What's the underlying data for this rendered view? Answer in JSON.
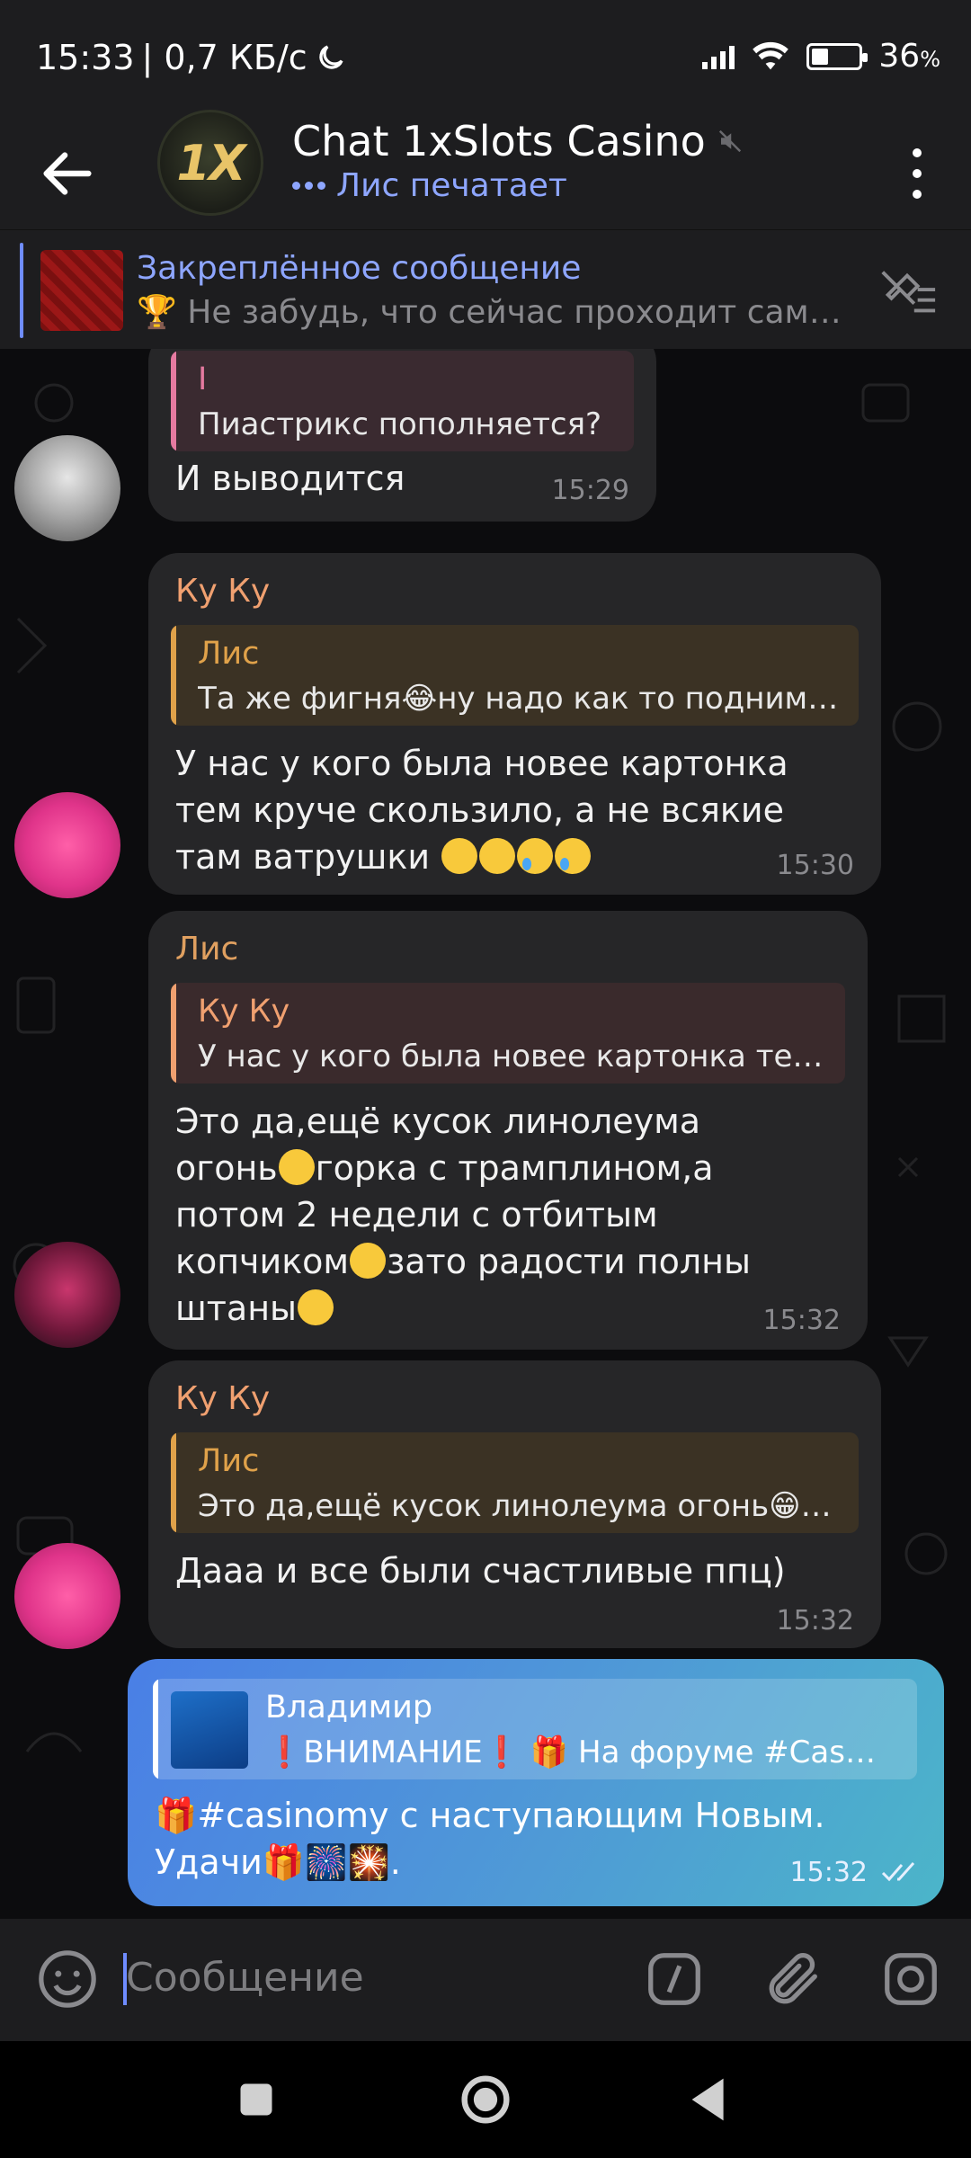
{
  "status_bar": {
    "time": "15:33",
    "speed": "| 0,7 КБ/с",
    "battery": "36",
    "battery_unit": "%",
    "battery_level": 0.36
  },
  "header": {
    "title": "Chat 1xSlots Casino",
    "avatar_text": "1X",
    "typing_text": "Лис печатает"
  },
  "pinned": {
    "title": "Закреплённое сообщение",
    "text": "🏆 Не забудь, что сейчас проходит самый…"
  },
  "messages": [
    {
      "reply_name": "I",
      "reply_text": "Пиастрикс пополняется?",
      "text": "И выводится",
      "time": "15:29"
    },
    {
      "sender": "Ку Ку",
      "reply_name": "Лис",
      "reply_text": "Та же фигня😂ну надо как то подним…",
      "text_lines": [
        "У нас у кого была новее картонка",
        "тем круче скользило, а не всякие",
        "там ватрушки"
      ],
      "time": "15:30"
    },
    {
      "sender": "Лис",
      "reply_name": "Ку Ку",
      "reply_text": "У нас у кого была новее картонка те…",
      "text_lines": [
        "Это да,ещё кусок линолеума",
        "огонь",
        "горка с трамплином,а",
        "потом 2 недели с отбитым",
        "копчиком",
        "зато радости полны",
        "штаны"
      ],
      "time": "15:32"
    },
    {
      "sender": "Ку Ку",
      "reply_name": "Лис",
      "reply_text": "Это да,ещё кусок линолеума огонь😁…",
      "text": "Дааа и все были счастливые ппц)",
      "time": "15:32"
    },
    {
      "reply_name": "Владимир",
      "reply_text": "❗ВНИМАНИЕ❗ 🎁 На форуме #Cas…",
      "text_line1": "🎁#casinomy с наступающим Новым.",
      "text_line2": "Удачи🎁🎆🎇.",
      "time": "15:32"
    }
  ],
  "input": {
    "placeholder": "Сообщение"
  },
  "colors": {
    "accent": "#8ea6ff",
    "name_orange": "#f0a070",
    "name_amber": "#e0a060",
    "reply_bar_pink": "#e57aa0",
    "reply_bar_amber": "#e0a24a",
    "bubble": "#262628",
    "outgoing_start": "#4a7fe6",
    "outgoing_end": "#4bb5c9"
  }
}
